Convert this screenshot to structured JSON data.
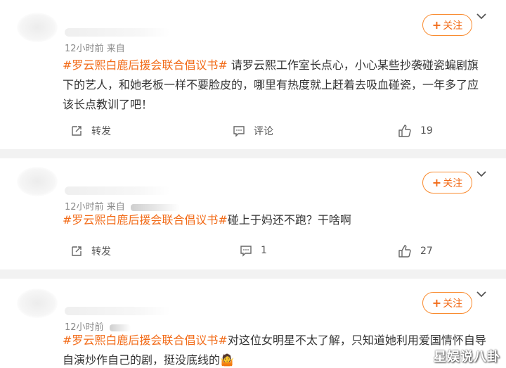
{
  "posts": [
    {
      "time": "12小时前",
      "source": "来自",
      "follow_label": "关注",
      "topic": "#罗云熙白鹿后援会联合倡议书#",
      "body": "请罗云熙工作室长点心，小心某些抄袭碰瓷蝙剧旗下的艺人，和她老板一样不要脸皮的，哪里有热度就上赶着去吸血碰瓷，一年多了应该长点教训了吧！",
      "repost_label": "转发",
      "comment_label": "评论",
      "like_count": "19"
    },
    {
      "time": "12小时前",
      "source": "来自",
      "follow_label": "关注",
      "topic": "#罗云熙白鹿后援会联合倡议书#",
      "body": "碰上于妈还不跑？干啥啊",
      "repost_label": "转发",
      "comment_count": "1",
      "like_count": "27"
    },
    {
      "time": "12小时前",
      "follow_label": "关注",
      "topic": "#罗云熙白鹿后援会联合倡议书#",
      "body": "对这位女明星不太了解，只知道她利用爱国情怀自导自演炒作自己的剧，挺没底线的🤷"
    }
  ],
  "watermark": "星娱说八卦",
  "colors": {
    "accent": "#f26b18",
    "text": "#333333",
    "meta": "#8a8a8a"
  },
  "icons": {
    "repost": "repost-icon",
    "comment": "comment-icon",
    "like": "thumbs-up-icon",
    "more": "chevron-down-icon"
  }
}
